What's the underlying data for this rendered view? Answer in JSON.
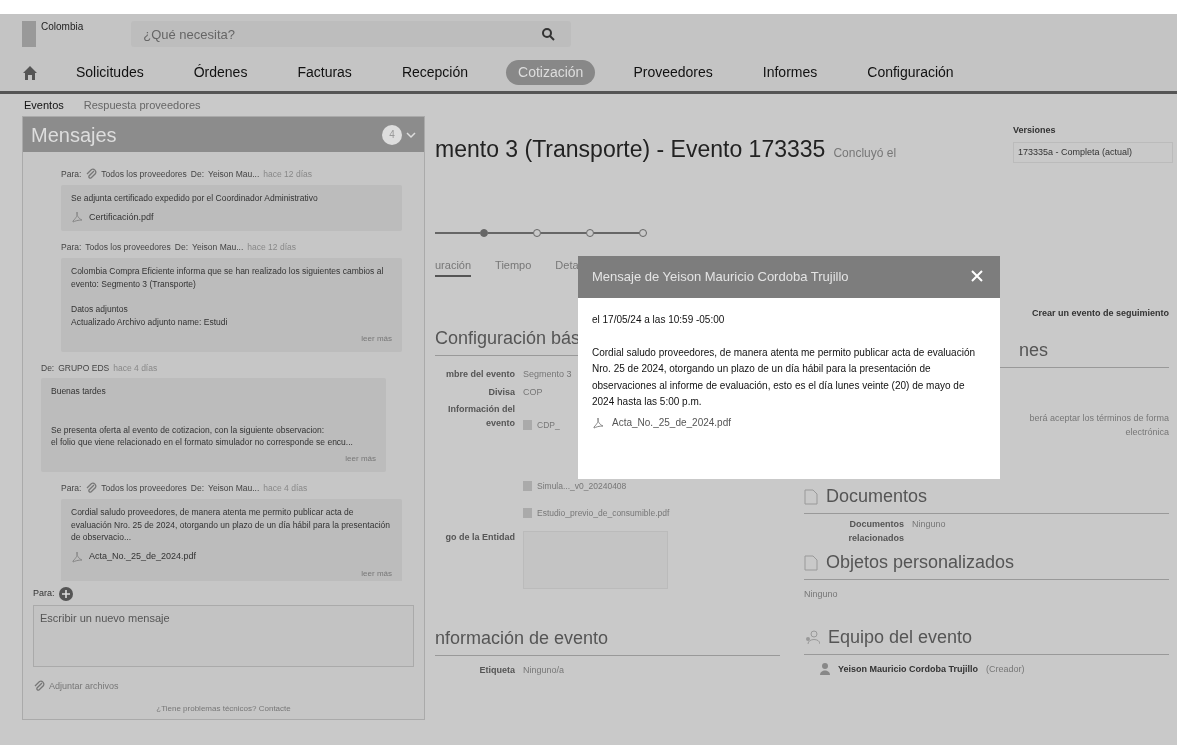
{
  "header": {
    "logo_text": "Colombia",
    "search": {
      "placeholder": "¿Qué necesita?"
    }
  },
  "nav": [
    {
      "label": "Solicitudes",
      "selected": false
    },
    {
      "label": "Órdenes",
      "selected": false
    },
    {
      "label": "Facturas",
      "selected": false
    },
    {
      "label": "Recepción",
      "selected": false
    },
    {
      "label": "Cotización",
      "selected": true
    },
    {
      "label": "Proveedores",
      "selected": false
    },
    {
      "label": "Informes",
      "selected": false
    },
    {
      "label": "Configuración",
      "selected": false
    }
  ],
  "subnav": [
    {
      "label": "Eventos",
      "selected": true
    },
    {
      "label": "Respuesta proveedores",
      "selected": false
    }
  ],
  "messages_panel": {
    "title": "Mensajes",
    "count": "4",
    "messages": [
      {
        "kind": "to",
        "to_label": "Para:",
        "attached": true,
        "recipient": "Todos los proveedores",
        "from_label": "De:",
        "sender": "Yeison Mau...",
        "time": "hace 12 días",
        "body": "Se adjunta certificado expedido por el Coordinador Administrativo",
        "attachment": "Certificación.pdf"
      },
      {
        "kind": "to",
        "to_label": "Para:",
        "attached": false,
        "recipient": "Todos los proveedores",
        "from_label": "De:",
        "sender": "Yeison Mau...",
        "time": "hace 12 días",
        "body": "Colombia Compra Eficiente informa que se han realizado los siguientes cambios al evento: Segmento 3 (Transporte)\n\nDatos adjuntos\nActualizado Archivo adjunto name: Estudi",
        "more": "leer más"
      },
      {
        "kind": "from",
        "from_label": "De:",
        "sender": "GRUPO EDS",
        "time": "hace 4 días",
        "body": "Buenas tardes\n\n\nSe presenta oferta al evento de cotizacion, con la siguiente observacion:\nel folio que viene relacionado en el formato simulador no corresponde se encu...",
        "more": "leer más"
      },
      {
        "kind": "to",
        "to_label": "Para:",
        "attached": true,
        "recipient": "Todos los proveedores",
        "from_label": "De:",
        "sender": "Yeison Mau...",
        "time": "hace 4 días",
        "body": "Cordial saludo proveedores, de manera atenta me permito publicar acta de evaluación Nro. 25 de 2024, otorgando un plazo de un día hábil para la presentación de observacio...",
        "attachment": "Acta_No._25_de_2024.pdf",
        "more": "leer más"
      }
    ],
    "compose": {
      "to_label": "Para:",
      "placeholder": "Escribir un nuevo mensaje",
      "attach": "Adjuntar archivos"
    },
    "footer": "¿Tiene problemas técnicos? Contacte"
  },
  "event": {
    "title": "mento 3 (Transporte) - Evento 173335",
    "status": "Concluyó el",
    "versions": {
      "label": "Versiones",
      "value": "173335a - Completa (actual)"
    },
    "steps": [
      {
        "completed": true
      },
      {
        "completed": false
      },
      {
        "completed": false
      },
      {
        "completed": false
      }
    ],
    "tabs": [
      {
        "label": "uración",
        "selected": true
      },
      {
        "label": "Tiempo",
        "selected": false
      },
      {
        "label": "Deta",
        "selected": false
      }
    ],
    "follow_up_link": "Crear un evento de seguimiento",
    "basic": {
      "heading": "Configuración bás",
      "fields": [
        {
          "label": "mbre del evento",
          "value": "Segmento 3"
        },
        {
          "label": "Divisa",
          "value": "COP"
        }
      ],
      "info_label": "Información del evento",
      "files": [
        "CDP_",
        "Simula..._v0_20240408",
        "Estudio_previo_de_consumible.pdf"
      ],
      "logo_label": "go de la Entidad"
    },
    "terms": {
      "heading": "nes",
      "text": "berá aceptar los términos de forma electrónica"
    },
    "documents": {
      "heading": "Documentos",
      "label": "Documentos relacionados",
      "value": "Ninguno"
    },
    "custom": {
      "heading": "Objetos personalizados",
      "value": "Ninguno"
    },
    "info": {
      "heading": "nformación de evento",
      "label": "Etiqueta",
      "value": "Ninguno/a"
    },
    "team": {
      "heading": "Equipo del evento",
      "member": "Yeison Mauricio Cordoba Trujillo",
      "role": "(Creador)"
    }
  },
  "modal": {
    "title": "Mensaje de Yeison Mauricio Cordoba Trujillo",
    "date": "el 17/05/24 a las 10:59 -05:00",
    "body": "Cordial saludo proveedores, de manera atenta me permito publicar acta de evaluación Nro. 25 de 2024, otorgando un plazo de un día hábil para la presentación de observaciones al informe de evaluación, esto es el día lunes veinte (20) de mayo de 2024 hasta las 5:00 p.m.",
    "attachment": "Acta_No._25_de_2024.pdf"
  }
}
